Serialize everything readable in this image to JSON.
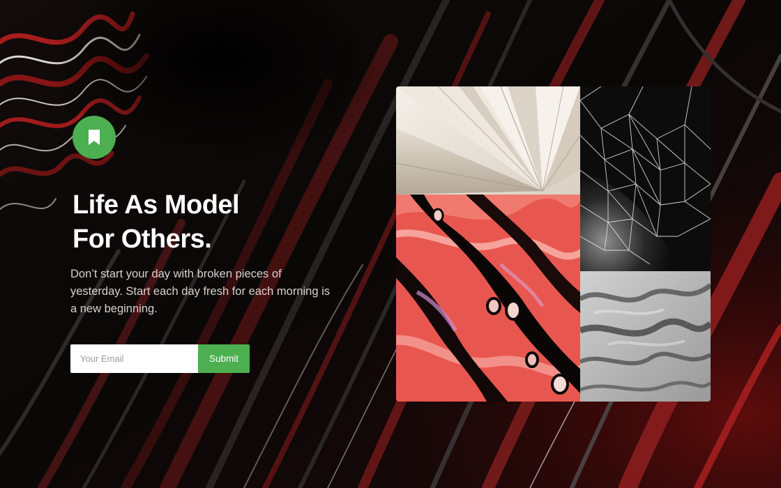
{
  "hero": {
    "badge_icon": "bookmark-icon",
    "title_line_1": "Life As Model",
    "title_line_2": "For Others.",
    "description": "Don’t start your day with broken pieces of yesterday. Start each day fresh for each morning is a new beginning."
  },
  "subscribe": {
    "email_placeholder": "Your Email",
    "email_value": "",
    "submit_label": "Submit"
  },
  "collage": {
    "tiles": [
      "folded-paper-image",
      "red-fluid-art-image",
      "wireframe-mesh-image",
      "rock-texture-image"
    ]
  },
  "colors": {
    "accent": "#4caf50",
    "background": "#090707",
    "text": "#ffffff",
    "muted_text": "#d8d2d2"
  }
}
